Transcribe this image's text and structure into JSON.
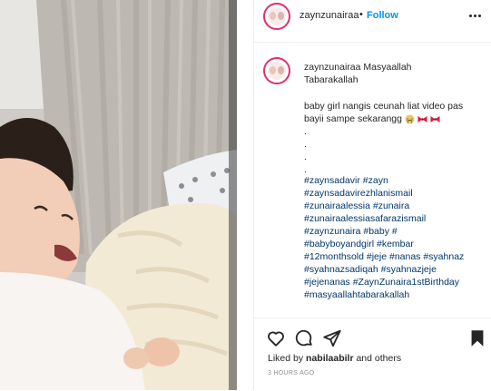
{
  "header": {
    "username": "zaynzunairaa",
    "separator": "•",
    "follow_label": "Follow"
  },
  "caption": {
    "username": "zaynzunairaa",
    "title_line1": "Masyaallah",
    "title_line2": "Tabarakallah",
    "body_lines": [
      "baby girl nangis ceunah liat video pas",
      "bayii sampe sekarangg"
    ],
    "dots": [
      ".",
      ".",
      ".",
      "."
    ],
    "hashtag_lines": [
      "#zaynsadavir #zayn",
      "#zaynsadavirezhlanismail",
      "#zunairaalessia #zunaira",
      "#zunairaalessiasafarazismail",
      "#zaynzunaira #baby #",
      "#babyboyandgirl #kembar",
      "#12monthsold #jeje #nanas #syahnaz",
      "#syahnazsadiqah #syahnazjeje",
      "#jejenanas #ZaynZunaira1stBirthday",
      "#masyaallahtabarakallah"
    ]
  },
  "footer": {
    "liked_prefix": "Liked by",
    "liked_user": "nabilaabilr",
    "liked_suffix": "and others",
    "timestamp": "3 HOURS AGO"
  },
  "icons": {
    "like": "heart-icon",
    "comment": "comment-icon",
    "share": "share-icon",
    "save": "bookmark-icon",
    "more": "more-options-icon"
  },
  "colors": {
    "follow": "#0095f6",
    "hashtag": "#00376b",
    "avatar_ring": "#e1306c",
    "text": "#262626",
    "muted": "#8e8e8e"
  }
}
